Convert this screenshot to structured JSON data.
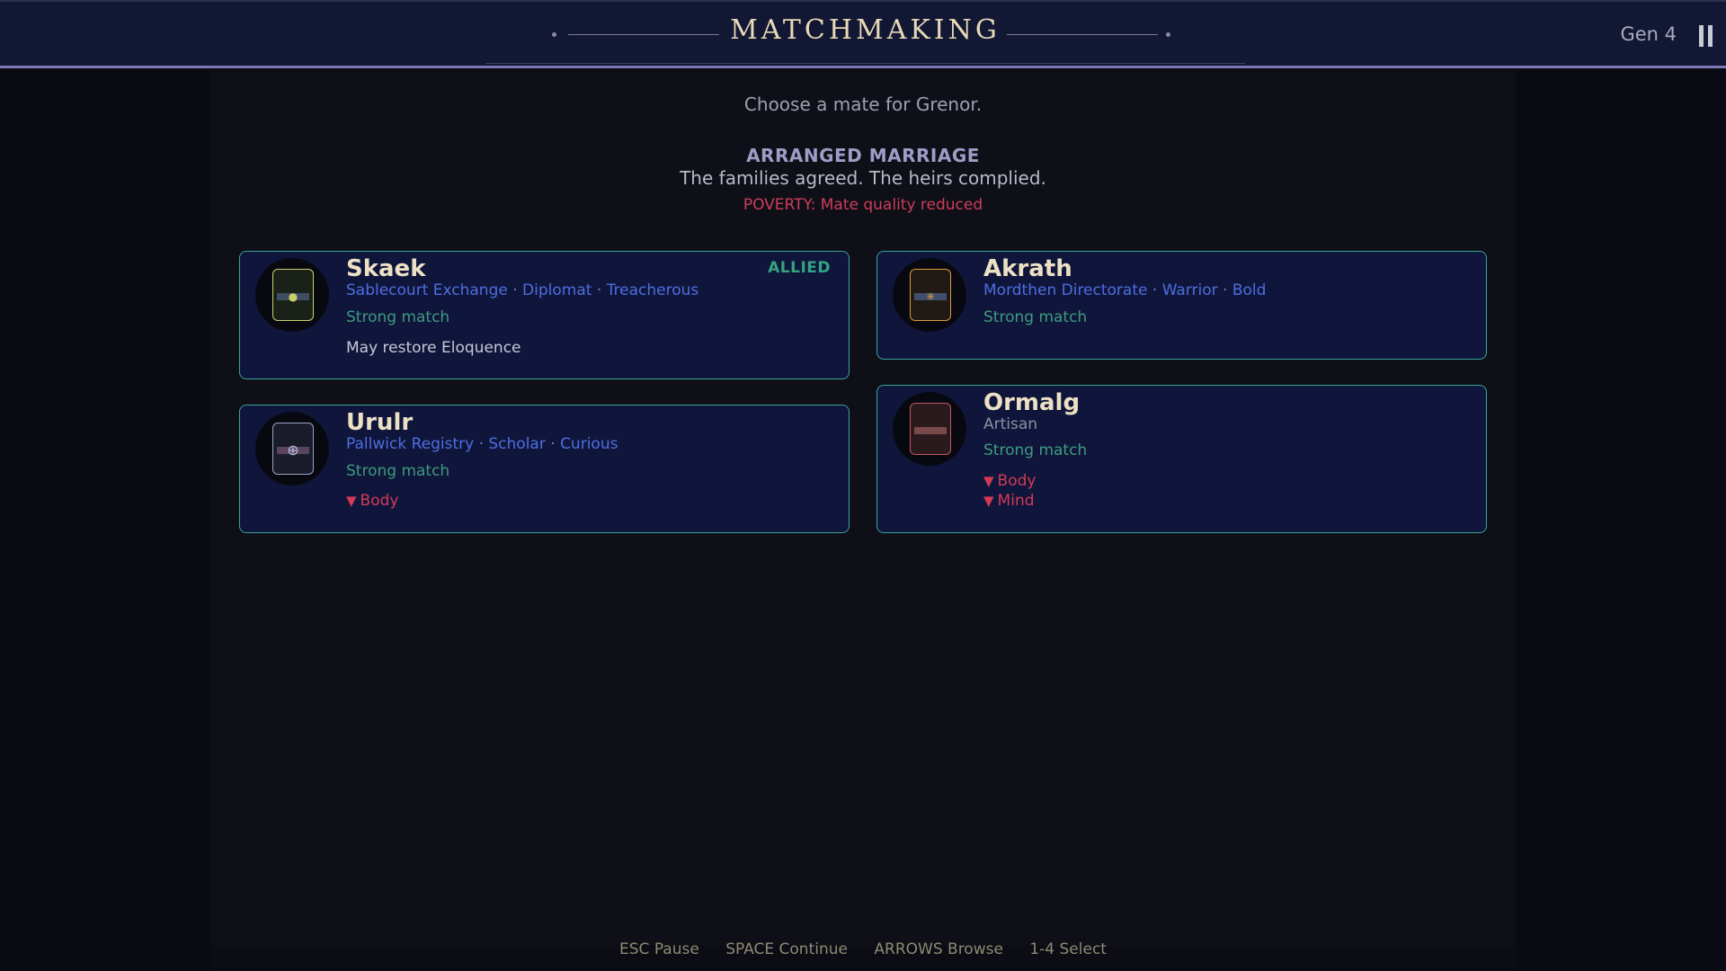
{
  "header": {
    "title": "MATCHMAKING",
    "generation": "Gen 4"
  },
  "intro": {
    "prompt": "Choose a mate for Grenor.",
    "event_title": "ARRANGED MARRIAGE",
    "event_description": "The families agreed. The heirs complied.",
    "warning": "POVERTY: Mate quality reduced"
  },
  "candidates": [
    {
      "name": "Skaek",
      "house": "Sablecourt Exchange",
      "role": "Diplomat",
      "trait": "Treacherous",
      "match": "Strong match",
      "note": "May restore Eloquence",
      "badge": "ALLIED",
      "crest_color": "#c9d06a",
      "crest_band": "#3e4d63"
    },
    {
      "name": "Akrath",
      "house": "Mordthen Directorate",
      "role": "Warrior",
      "trait": "Bold",
      "match": "Strong match",
      "crest_color": "#d99a3e",
      "crest_band": "#3f4f69"
    },
    {
      "name": "Urulr",
      "house": "Pallwick Registry",
      "role": "Scholar",
      "trait": "Curious",
      "match": "Strong match",
      "debuffs": [
        "Body"
      ],
      "crest_color": "#9aa2c8",
      "crest_band": "#5a4560"
    },
    {
      "name": "Ormalg",
      "role": "Artisan",
      "match": "Strong match",
      "debuffs": [
        "Body",
        "Mind"
      ],
      "crest_color": "#c05a62",
      "crest_band": "#7a4a4a"
    }
  ],
  "footer": {
    "hints": [
      "ESC Pause",
      "SPACE Continue",
      "ARROWS Browse",
      "1-4 Select"
    ]
  },
  "colors": {
    "accent_teal": "#3aa39a",
    "trait_blue": "#4c6ee0",
    "warning_red": "#cf3d5a",
    "name_cream": "#ece1c4"
  }
}
